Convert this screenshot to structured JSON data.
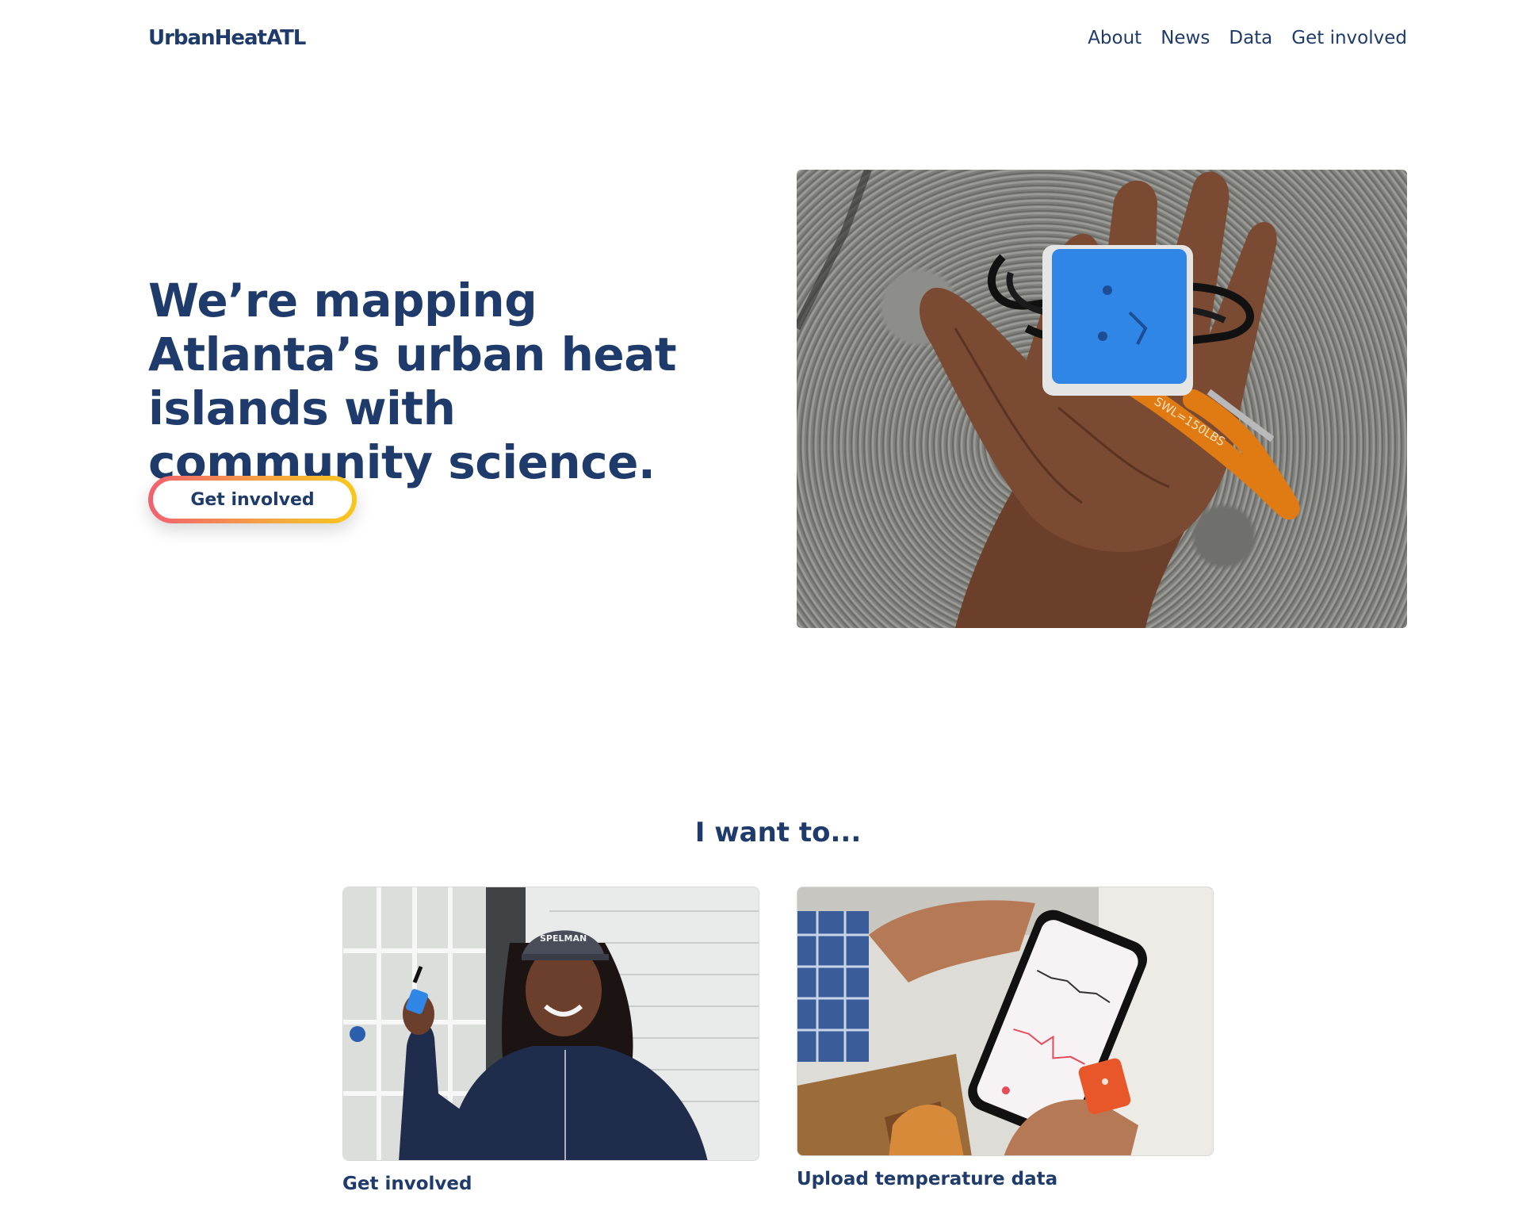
{
  "header": {
    "brand": "UrbanHeatATL",
    "nav": [
      {
        "label": "About"
      },
      {
        "label": "News"
      },
      {
        "label": "Data"
      },
      {
        "label": "Get involved"
      }
    ]
  },
  "hero": {
    "title": "We’re mapping Atlanta’s urban heat islands with community science.",
    "cta_label": "Get involved",
    "photo_label": "SWL=150LBS"
  },
  "section": {
    "title": "I want to...",
    "cards": [
      {
        "label": "Get involved",
        "cap_text": "SPELMAN"
      },
      {
        "label": "Upload temperature data"
      }
    ]
  },
  "colors": {
    "primary": "#1f3b6b",
    "gradient_start": "#f2606f",
    "gradient_end": "#f7c81c",
    "sensor_blue": "#2f86e6",
    "sensor_orange": "#e8572a"
  }
}
